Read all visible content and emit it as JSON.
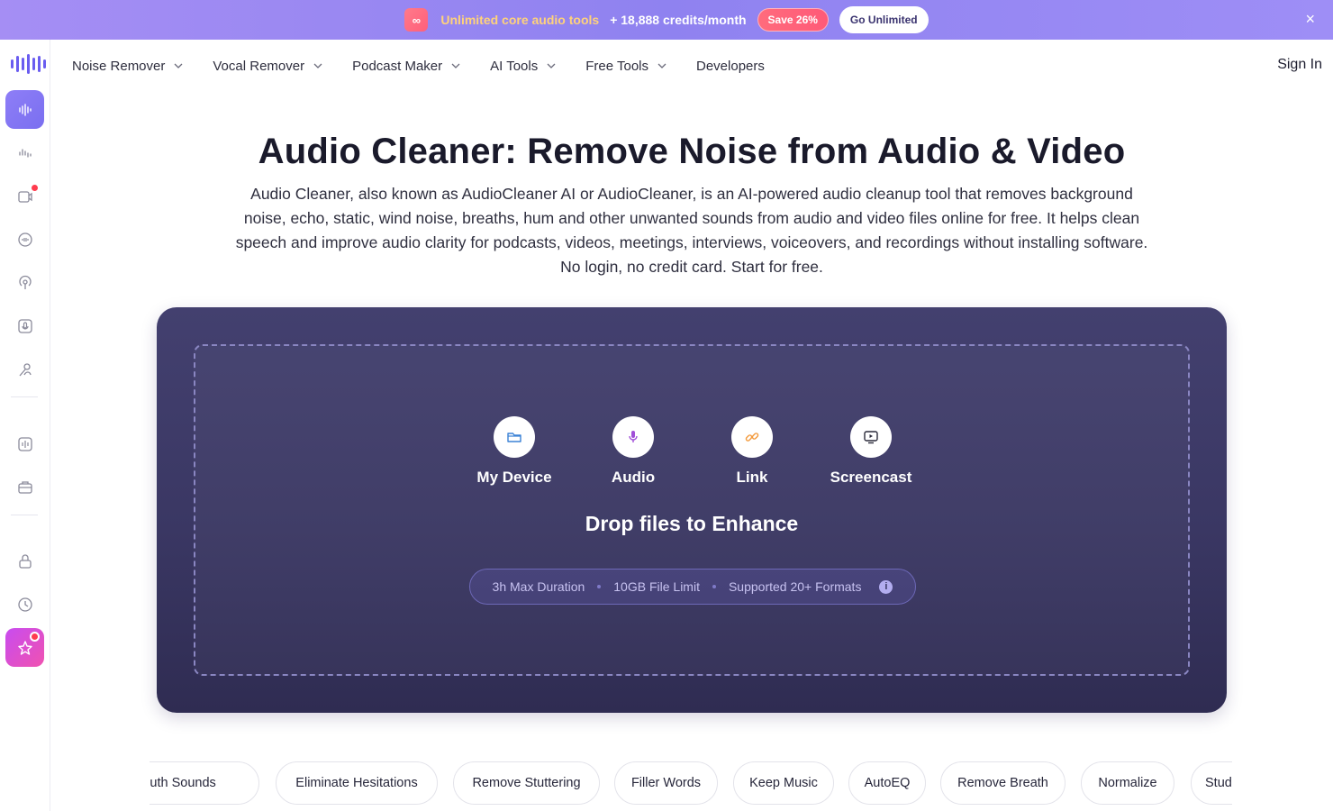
{
  "promo": {
    "badge_icon": "infinity-icon",
    "badge_text": "∞",
    "text": "Unlimited core audio tools",
    "credits": "+ 18,888 credits/month",
    "save": "Save 26%",
    "cta": "Go Unlimited",
    "close": "×"
  },
  "sidebar": {
    "items": [
      {
        "icon": "waveform-icon",
        "active": true
      },
      {
        "icon": "audio-bars-icon"
      },
      {
        "icon": "video-edit-icon",
        "badge": true
      },
      {
        "icon": "speed-gauge-icon"
      },
      {
        "icon": "podcast-icon"
      },
      {
        "icon": "mic-box-icon"
      },
      {
        "icon": "voice-person-icon"
      },
      {
        "icon": "audio-panel-icon"
      },
      {
        "icon": "toolbox-icon"
      },
      {
        "icon": "lock-icon"
      },
      {
        "icon": "history-icon"
      },
      {
        "icon": "star-icon",
        "badge": true
      }
    ]
  },
  "nav": {
    "items": [
      {
        "label": "Noise Remover",
        "dropdown": true
      },
      {
        "label": "Vocal Remover",
        "dropdown": true
      },
      {
        "label": "Podcast Maker",
        "dropdown": true
      },
      {
        "label": "AI Tools",
        "dropdown": true
      },
      {
        "label": "Free Tools",
        "dropdown": true
      },
      {
        "label": "Developers",
        "dropdown": false
      }
    ],
    "signin": "Sign In"
  },
  "hero": {
    "title": "Audio Cleaner: Remove Noise from Audio & Video",
    "description": "Audio Cleaner, also known as AudioCleaner AI or AudioCleaner, is an AI-powered audio cleanup tool that removes background noise, echo, static, wind noise, breaths, hum and other unwanted sounds from audio and video files online for free. It helps clean speech and improve audio clarity for podcasts, videos, meetings, interviews, voiceovers, and recordings without installing software. No login, no credit card. Start for free."
  },
  "upload": {
    "sources": [
      {
        "label": "My Device",
        "icon": "folder-icon",
        "color": "#3b82d6"
      },
      {
        "label": "Audio",
        "icon": "microphone-icon",
        "color": "#a14fd8"
      },
      {
        "label": "Link",
        "icon": "link-icon",
        "color": "#f39a3c"
      },
      {
        "label": "Screencast",
        "icon": "screen-record-icon",
        "color": "#2a2a3a"
      }
    ],
    "drop_title": "Drop files to Enhance",
    "limits": {
      "duration": "3h Max Duration",
      "size": "10GB File Limit",
      "formats": "Supported 20+ Formats",
      "info": "i"
    }
  },
  "chips": [
    "Remove Mouth Sounds",
    "Eliminate Hesitations",
    "Remove Stuttering",
    "Filler Words",
    "Keep Music",
    "AutoEQ",
    "Remove Breath",
    "Normalize",
    "Studio Sound"
  ],
  "colors": {
    "accent": "#6a5df0",
    "promo_text": "#ffd27a",
    "card_bg": "#3a3763"
  }
}
